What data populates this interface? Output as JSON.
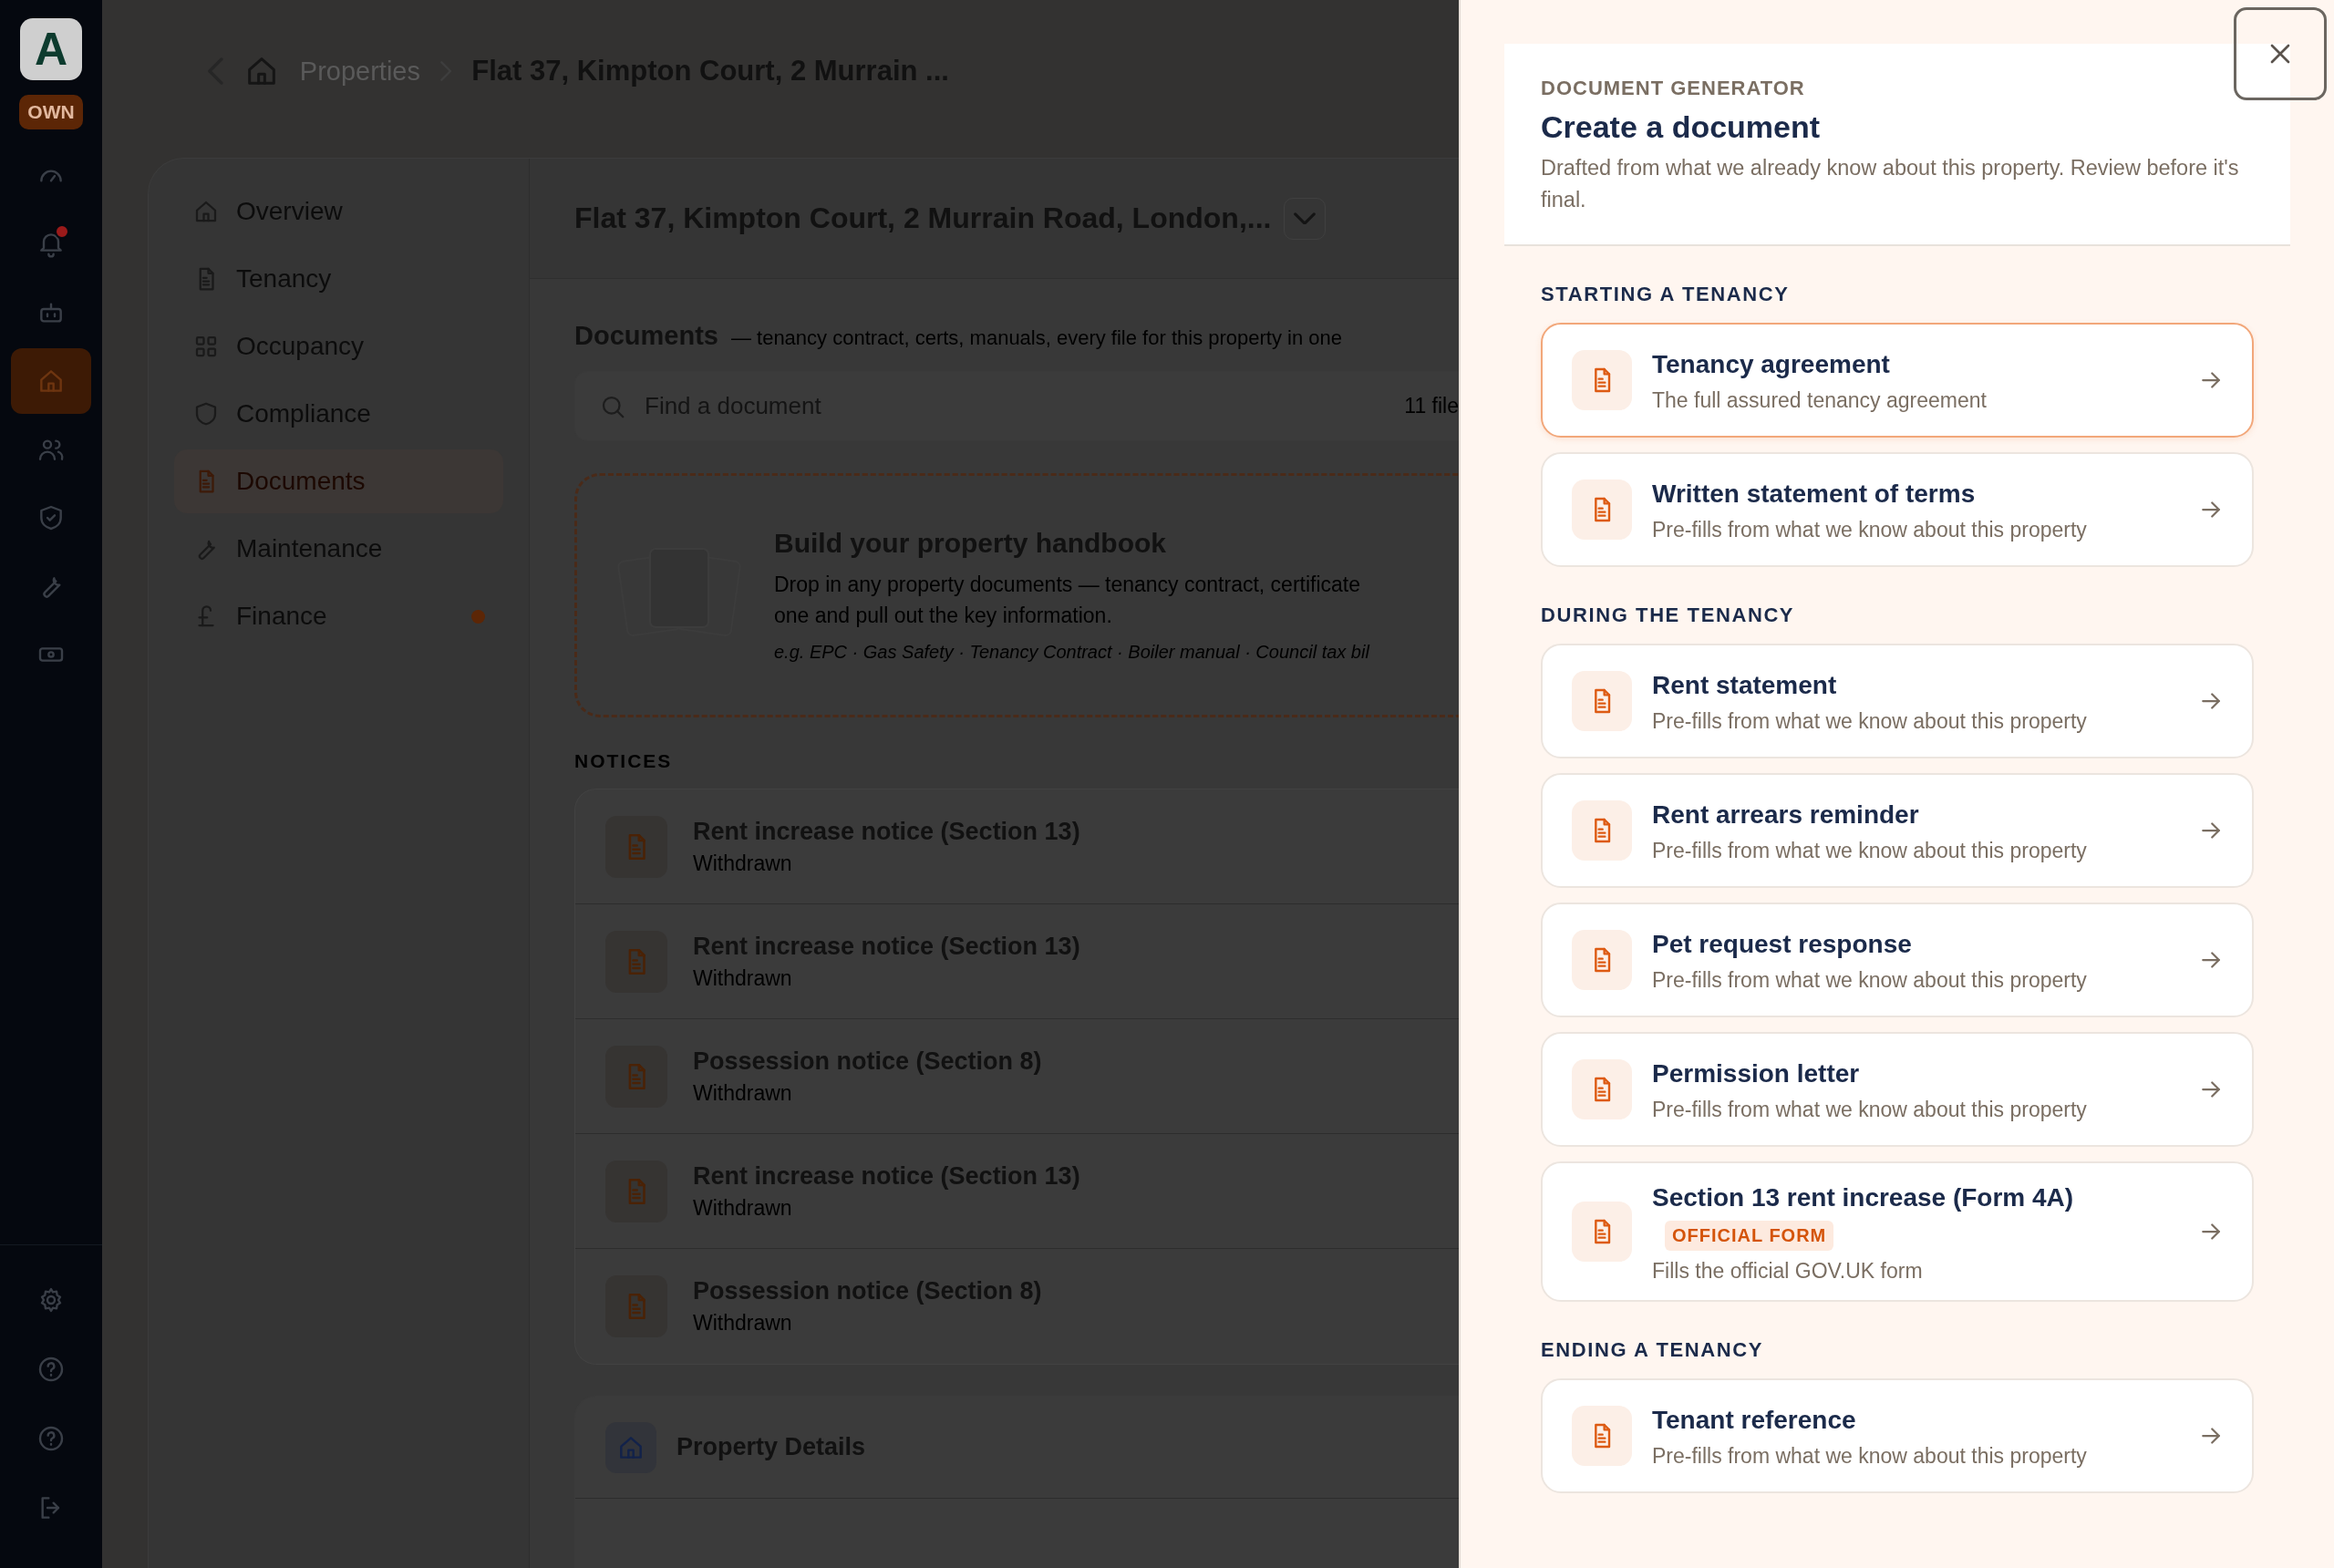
{
  "rail": {
    "logo": "A",
    "badge": "OWN",
    "items": [
      {
        "selected": false,
        "alert": false
      },
      {
        "selected": false,
        "alert": true
      },
      {
        "selected": false,
        "alert": false
      },
      {
        "selected": true,
        "alert": false
      },
      {
        "selected": false,
        "alert": false
      },
      {
        "selected": false,
        "alert": false
      },
      {
        "selected": false,
        "alert": false
      },
      {
        "selected": false,
        "alert": false
      }
    ]
  },
  "breadcrumb": {
    "items": [
      "Properties",
      "Flat 37, Kimpton Court, 2 Murrain ..."
    ]
  },
  "property_nav": {
    "items": [
      {
        "label": "Overview",
        "selected": false,
        "alert": false
      },
      {
        "label": "Tenancy",
        "selected": false,
        "alert": false
      },
      {
        "label": "Occupancy",
        "selected": false,
        "alert": false
      },
      {
        "label": "Compliance",
        "selected": false,
        "alert": false
      },
      {
        "label": "Documents",
        "selected": true,
        "alert": false
      },
      {
        "label": "Maintenance",
        "selected": false,
        "alert": false
      },
      {
        "label": "Finance",
        "selected": false,
        "alert": true
      }
    ]
  },
  "property_header": {
    "title": "Flat 37, Kimpton Court, 2 Murrain Road, London,..."
  },
  "documents": {
    "title": "Documents",
    "description": "— tenancy contract, certs, manuals, every file for this property in one",
    "search": {
      "placeholder": "Find a document"
    },
    "count": "11 file",
    "handbook": {
      "title": "Build your property handbook",
      "description": "Drop in any property documents — tenancy contract, certificate",
      "description_2": "one and pull out the key information.",
      "examples": "e.g. EPC · Gas Safety · Tenancy Contract · Boiler manual · Council tax bil"
    },
    "notices": {
      "heading": "NOTICES",
      "items": [
        {
          "title": "Rent increase notice (Section 13)",
          "status": "Withdrawn"
        },
        {
          "title": "Rent increase notice (Section 13)",
          "status": "Withdrawn"
        },
        {
          "title": "Possession notice (Section 8)",
          "status": "Withdrawn"
        },
        {
          "title": "Rent increase notice (Section 13)",
          "status": "Withdrawn"
        },
        {
          "title": "Possession notice (Section 8)",
          "status": "Withdrawn"
        }
      ]
    },
    "property_details": {
      "title": "Property Details"
    }
  },
  "drawer": {
    "eyebrow": "DOCUMENT GENERATOR",
    "title": "Create a document",
    "description": "Drafted from what we already know about this property. Review before it's final.",
    "sections": [
      {
        "heading": "STARTING A TENANCY",
        "items": [
          {
            "title": "Tenancy agreement",
            "description": "The full assured tenancy agreement",
            "selected": true
          },
          {
            "title": "Written statement of terms",
            "description": "Pre-fills from what we know about this property",
            "selected": false
          }
        ]
      },
      {
        "heading": "DURING THE TENANCY",
        "items": [
          {
            "title": "Rent statement",
            "description": "Pre-fills from what we know about this property",
            "selected": false
          },
          {
            "title": "Rent arrears reminder",
            "description": "Pre-fills from what we know about this property",
            "selected": false
          },
          {
            "title": "Pet request response",
            "description": "Pre-fills from what we know about this property",
            "selected": false
          },
          {
            "title": "Permission letter",
            "description": "Pre-fills from what we know about this property",
            "selected": false
          },
          {
            "title": "Section 13 rent increase (Form 4A)",
            "badge": "OFFICIAL FORM",
            "description": "Fills the official GOV.UK form",
            "selected": false
          }
        ]
      },
      {
        "heading": "ENDING A TENANCY",
        "items": [
          {
            "title": "Tenant reference",
            "description": "Pre-fills from what we know about this property",
            "selected": false
          }
        ]
      }
    ]
  }
}
